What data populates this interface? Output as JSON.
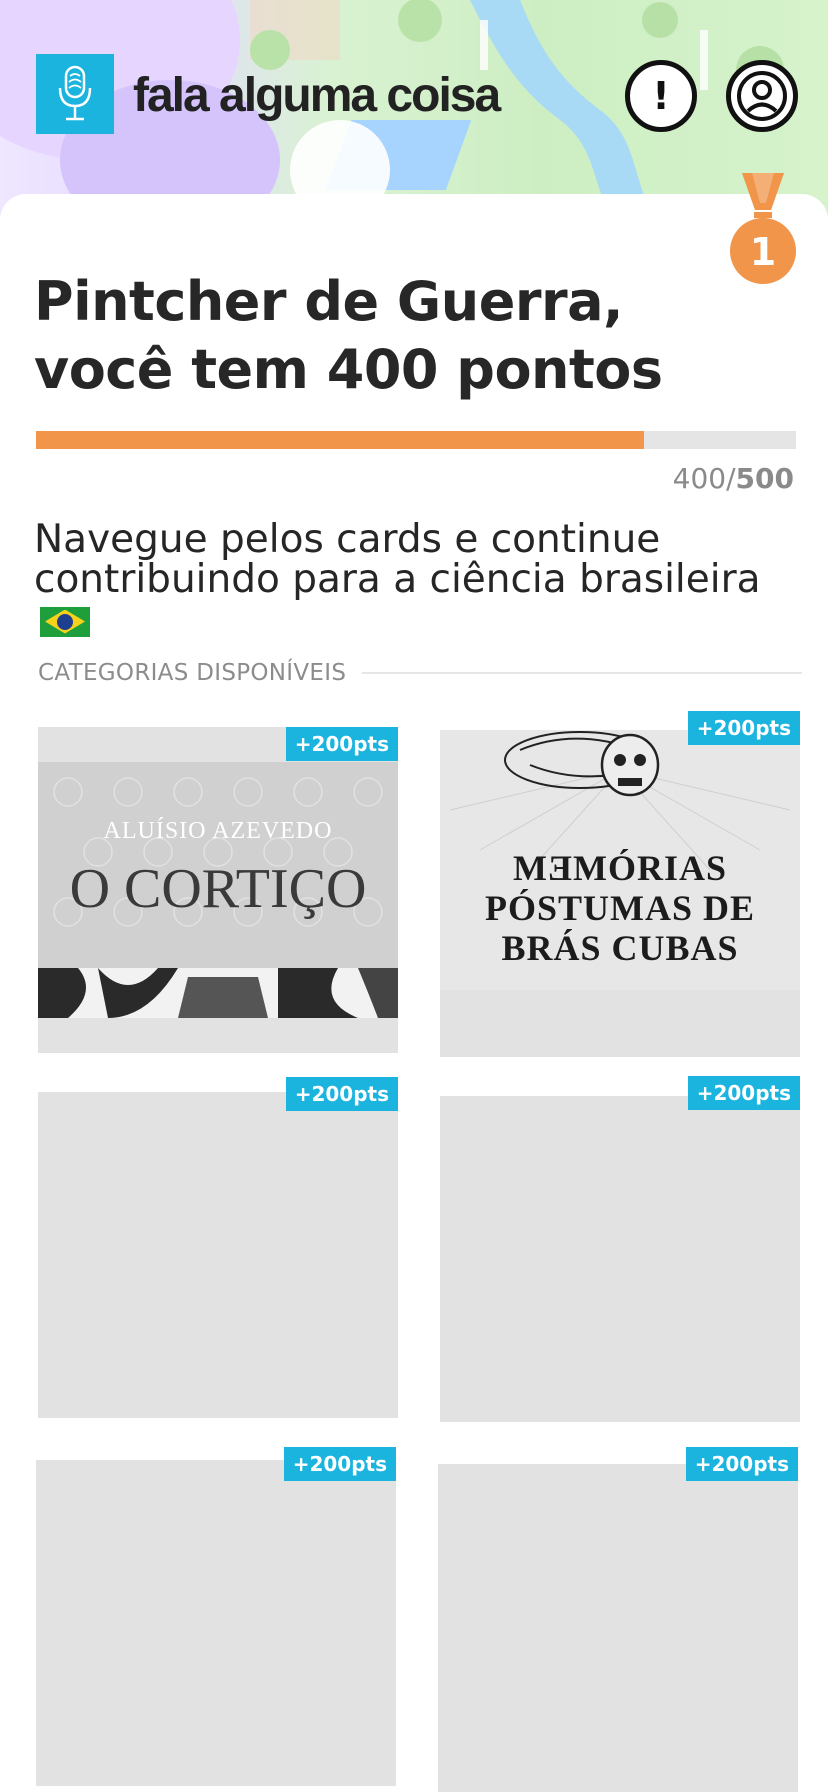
{
  "header": {
    "app_title": "fala alguma coisa",
    "logo_icon": "microphone-fingerprint-icon",
    "alert_icon": "exclamation-icon",
    "alert_glyph": "!",
    "profile_icon": "user-circle-icon",
    "brand_color": "#1ab4df"
  },
  "medal": {
    "rank": "1",
    "color": "#f0954a"
  },
  "greeting": {
    "name_line": "Pintcher de Guerra,",
    "prefix": "você tem ",
    "points": "400",
    "suffix": " pontos"
  },
  "progress": {
    "current": "400",
    "separator": "/",
    "goal": "500",
    "fraction": 0.8,
    "color": "#f0954a"
  },
  "subtitle": {
    "line1": "Navegue pelos cards e continue",
    "line2": "contribuindo para a ciência brasileira",
    "flag_icon": "brazil-flag-icon"
  },
  "section": {
    "label": "CATEGORIAS DISPONÍVEIS"
  },
  "cards": [
    {
      "badge": "+200pts",
      "cover_author": "ALUÍSIO AZEVEDO",
      "cover_title": "O CORTIÇO"
    },
    {
      "badge": "+200pts",
      "cover_title_lines": [
        "MƎMÓRIAS",
        "PÓSTUMAS DE",
        "BRÁS CUBAS"
      ]
    },
    {
      "badge": "+200pts"
    },
    {
      "badge": "+200pts"
    },
    {
      "badge": "+200pts"
    },
    {
      "badge": "+200pts"
    }
  ]
}
